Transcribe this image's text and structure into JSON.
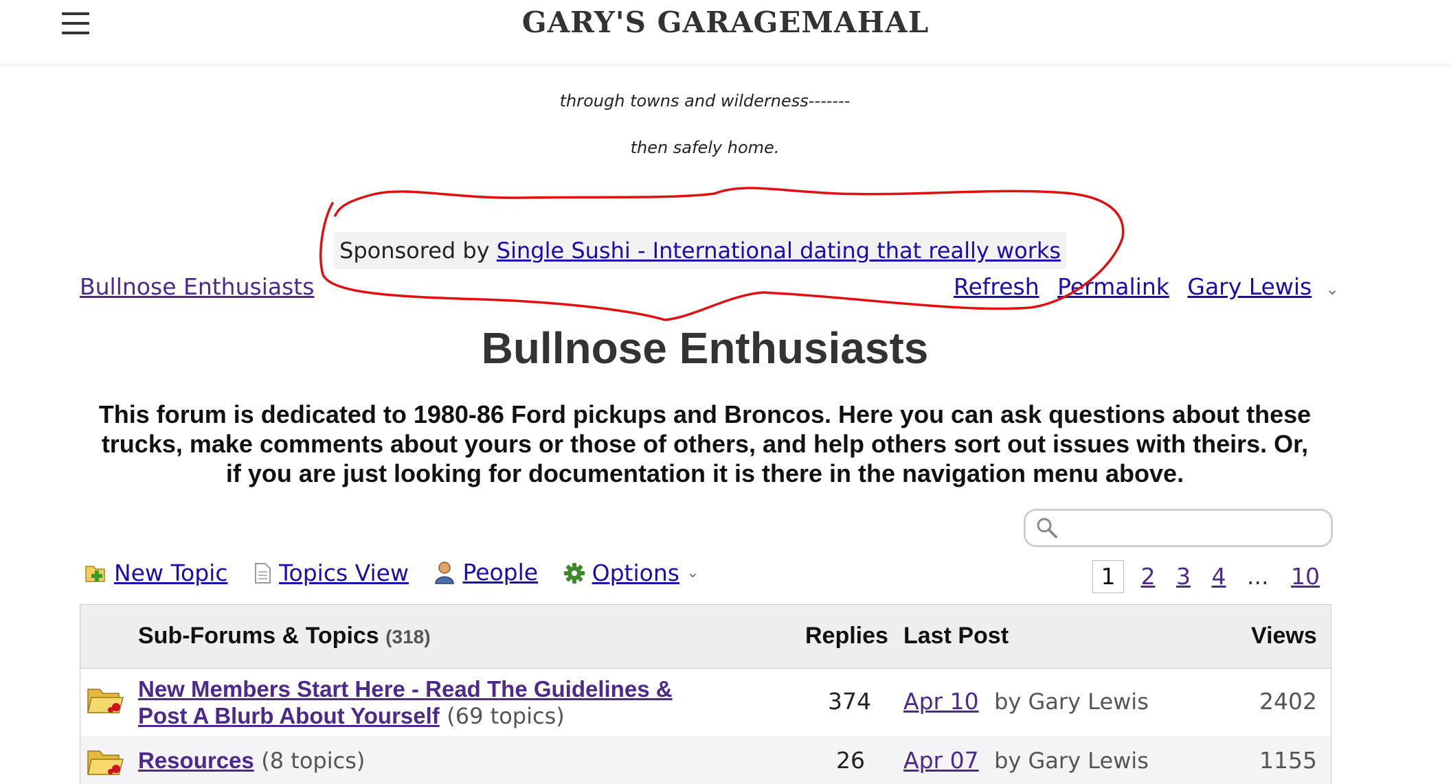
{
  "header": {
    "site_title": "GARY'S GARAGEMAHAL"
  },
  "intro": {
    "line1": "through towns and wilderness-------",
    "line2": "then safely home."
  },
  "sponsor": {
    "prefix": "Sponsored by",
    "link": "Single Sushi - International dating that really works"
  },
  "breadcrumb": "Bullnose Enthusiasts",
  "top_links": {
    "refresh": "Refresh",
    "permalink": "Permalink",
    "user": "Gary Lewis"
  },
  "forum": {
    "title": "Bullnose Enthusiasts",
    "description": "This forum is dedicated to 1980-86 Ford pickups and Broncos.  Here you can ask questions about these trucks, make comments about yours or those of others, and help others sort out issues with theirs. Or, if you are just looking for documentation it is there in the navigation menu above."
  },
  "search": {
    "placeholder": ""
  },
  "toolbar": {
    "new_topic": "New Topic",
    "topics_view": "Topics View",
    "people": "People",
    "options": "Options"
  },
  "pagination": {
    "current": "1",
    "pages": [
      "2",
      "3",
      "4"
    ],
    "ellipsis": "...",
    "last": "10"
  },
  "table": {
    "headers": {
      "topics": "Sub-Forums & Topics",
      "topics_count": "(318)",
      "replies": "Replies",
      "last_post": "Last Post",
      "views": "Views"
    },
    "rows": [
      {
        "title_line1": "New Members Start Here - Read The Guidelines &",
        "title_line2": "Post A Blurb About Yourself",
        "topics": "(69 topics)",
        "replies": "374",
        "last_post_date": "Apr 10",
        "last_post_by": "by Gary Lewis",
        "views": "2402"
      },
      {
        "title": "Resources",
        "topics": "(8 topics)",
        "replies": "26",
        "last_post_date": "Apr 07",
        "last_post_by": "by Gary Lewis",
        "views": "1155"
      }
    ]
  },
  "colors": {
    "link_visited": "#4b2a8c",
    "link": "#1a0dab",
    "annotation": "#e01010",
    "table_header_bg": "#eeeef0"
  }
}
